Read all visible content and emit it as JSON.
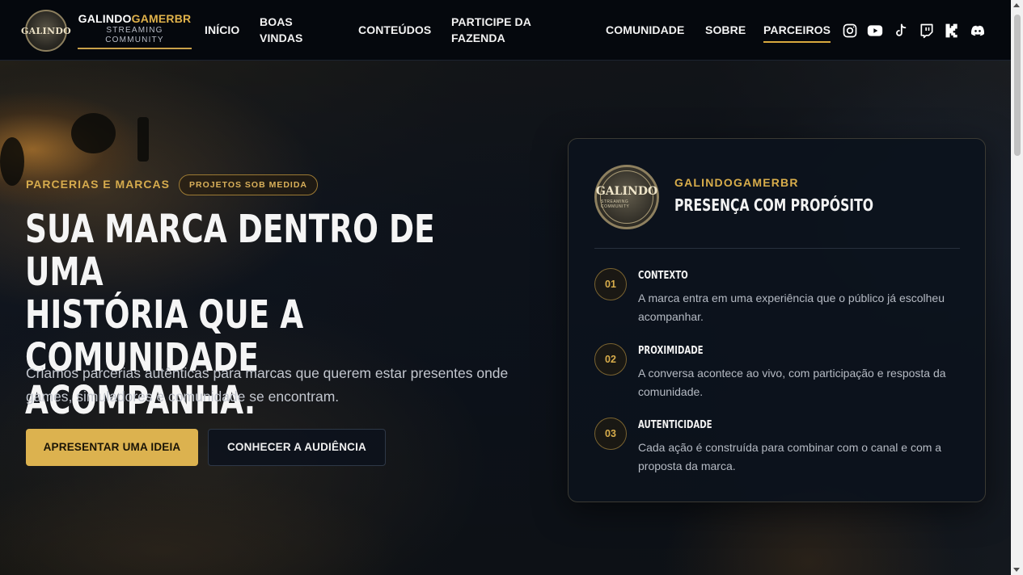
{
  "brand": {
    "logo_text": "GALINDO",
    "name_part1": "GALINDO",
    "name_part2": "GAMERBR",
    "subtitle_line1": "STREAMING",
    "subtitle_line2": "COMMUNITY"
  },
  "nav": {
    "items": [
      {
        "label": "INÍCIO"
      },
      {
        "label": "BOAS VINDAS"
      },
      {
        "label": "CONTEÚDOS"
      },
      {
        "label": "PARTICIPE DA FAZENDA"
      },
      {
        "label": "COMUNIDADE"
      },
      {
        "label": "SOBRE"
      },
      {
        "label": "PARCEIROS",
        "active": true
      }
    ]
  },
  "social": [
    "instagram-icon",
    "youtube-icon",
    "tiktok-icon",
    "twitch-icon",
    "kick-icon",
    "discord-icon"
  ],
  "hero": {
    "eyebrow": "PARCERIAS E MARCAS",
    "pill": "PROJETOS SOB MEDIDA",
    "title_lines": [
      "SUA MARCA DENTRO DE UMA",
      "HISTÓRIA QUE A COMUNIDADE",
      "ACOMPANHA."
    ],
    "lead": "Criamos parcerias autênticas para marcas que querem estar presentes onde games, simuladores e comunidade se encontram.",
    "primary_button": "APRESENTAR UMA IDEIA",
    "secondary_button": "CONHECER A AUDIÊNCIA"
  },
  "card": {
    "logo_text": "GALINDO",
    "logo_sub": "STREAMING COMMUNITY",
    "brand": "GALINDOGAMERBR",
    "title": "PRESENÇA COM PROPÓSITO",
    "steps": [
      {
        "num": "01",
        "title": "CONTEXTO",
        "text": "A marca entra em uma experiência que o público já escolheu acompanhar."
      },
      {
        "num": "02",
        "title": "PROXIMIDADE",
        "text": "A conversa acontece ao vivo, com participação e resposta da comunidade."
      },
      {
        "num": "03",
        "title": "AUTENTICIDADE",
        "text": "Cada ação é construída para combinar com o canal e com a proposta da marca."
      }
    ]
  },
  "colors": {
    "accent": "#dcb24f",
    "background": "#0b1018",
    "header": "#05080d"
  }
}
